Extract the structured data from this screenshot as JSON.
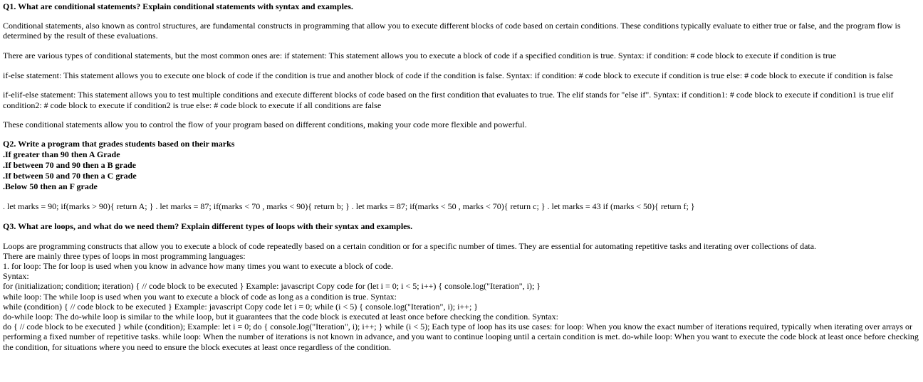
{
  "q1": {
    "heading": "Q1. What are conditional statements? Explain conditional statements with syntax and examples.",
    "paragraphs": [
      "Conditional statements, also known as control structures, are fundamental constructs in programming that allow you to execute different blocks of code based on certain conditions. These conditions typically evaluate to either true or false, and the program flow is determined by the result of these evaluations.",
      "There are various types of conditional statements, but the most common ones are: if statement: This statement allows you to execute a block of code if a specified condition is true. Syntax: if condition: # code block to execute if condition is true",
      "if-else statement: This statement allows you to execute one block of code if the condition is true and another block of code if the condition is false. Syntax: if condition: # code block to execute if condition is true else: # code block to execute if condition is false",
      "if-elif-else statement: This statement allows you to test multiple conditions and execute different blocks of code based on the first condition that evaluates to true. The elif stands for \"else if\". Syntax: if condition1: # code block to execute if condition1 is true elif condition2: # code block to execute if condition2 is true else: # code block to execute if all conditions are false",
      "These conditional statements allow you to control the flow of your program based on different conditions, making your code more flexible and powerful."
    ]
  },
  "q2": {
    "lines": [
      "Q2. Write a program that grades students based on their marks",
      ".If greater than 90 then A Grade",
      ".If between 70 and 90 then a B grade",
      ".If between 50 and 70 then a C grade",
      ".Below 50 then an F grade"
    ],
    "answer": ". let marks = 90; if(marks > 90){ return A; } . let marks = 87; if(marks < 70 , marks < 90){ return b; } . let marks = 87; if(marks < 50 , marks < 70){ return c; } . let marks = 43 if (marks < 50){ return f; }"
  },
  "q3": {
    "heading": "Q3. What are loops, and what do we need them? Explain different types of loops with their syntax and examples.",
    "lines": [
      "Loops are programming constructs that allow you to execute a block of code repeatedly based on a certain condition or for a specific number of times. They are essential for automating repetitive tasks and iterating over collections of data.",
      "There are mainly three types of loops in most programming languages:",
      "1. for loop: The for loop is used when you know in advance how many times you want to execute a block of code.",
      "Syntax:",
      "for (initialization; condition; iteration) { // code block to be executed } Example: javascript Copy code for (let i = 0; i < 5; i++) { console.log(\"Iteration\", i); }",
      "while loop: The while loop is used when you want to execute a block of code as long as a condition is true. Syntax:",
      "while (condition) { // code block to be executed } Example: javascript Copy code let i = 0; while (i < 5) { console.log(\"Iteration\", i); i++; }",
      "do-while loop: The do-while loop is similar to the while loop, but it guarantees that the code block is executed at least once before checking the condition. Syntax:",
      "do { // code block to be executed } while (condition); Example: let i = 0; do { console.log(\"Iteration\", i); i++; } while (i < 5); Each type of loop has its use cases: for loop: When you know the exact number of iterations required, typically when iterating over arrays or performing a fixed number of repetitive tasks. while loop: When the number of iterations is not known in advance, and you want to continue looping until a certain condition is met. do-while loop: When you want to execute the code block at least once before checking the condition, for situations where you need to ensure the block executes at least once regardless of the condition."
    ]
  }
}
